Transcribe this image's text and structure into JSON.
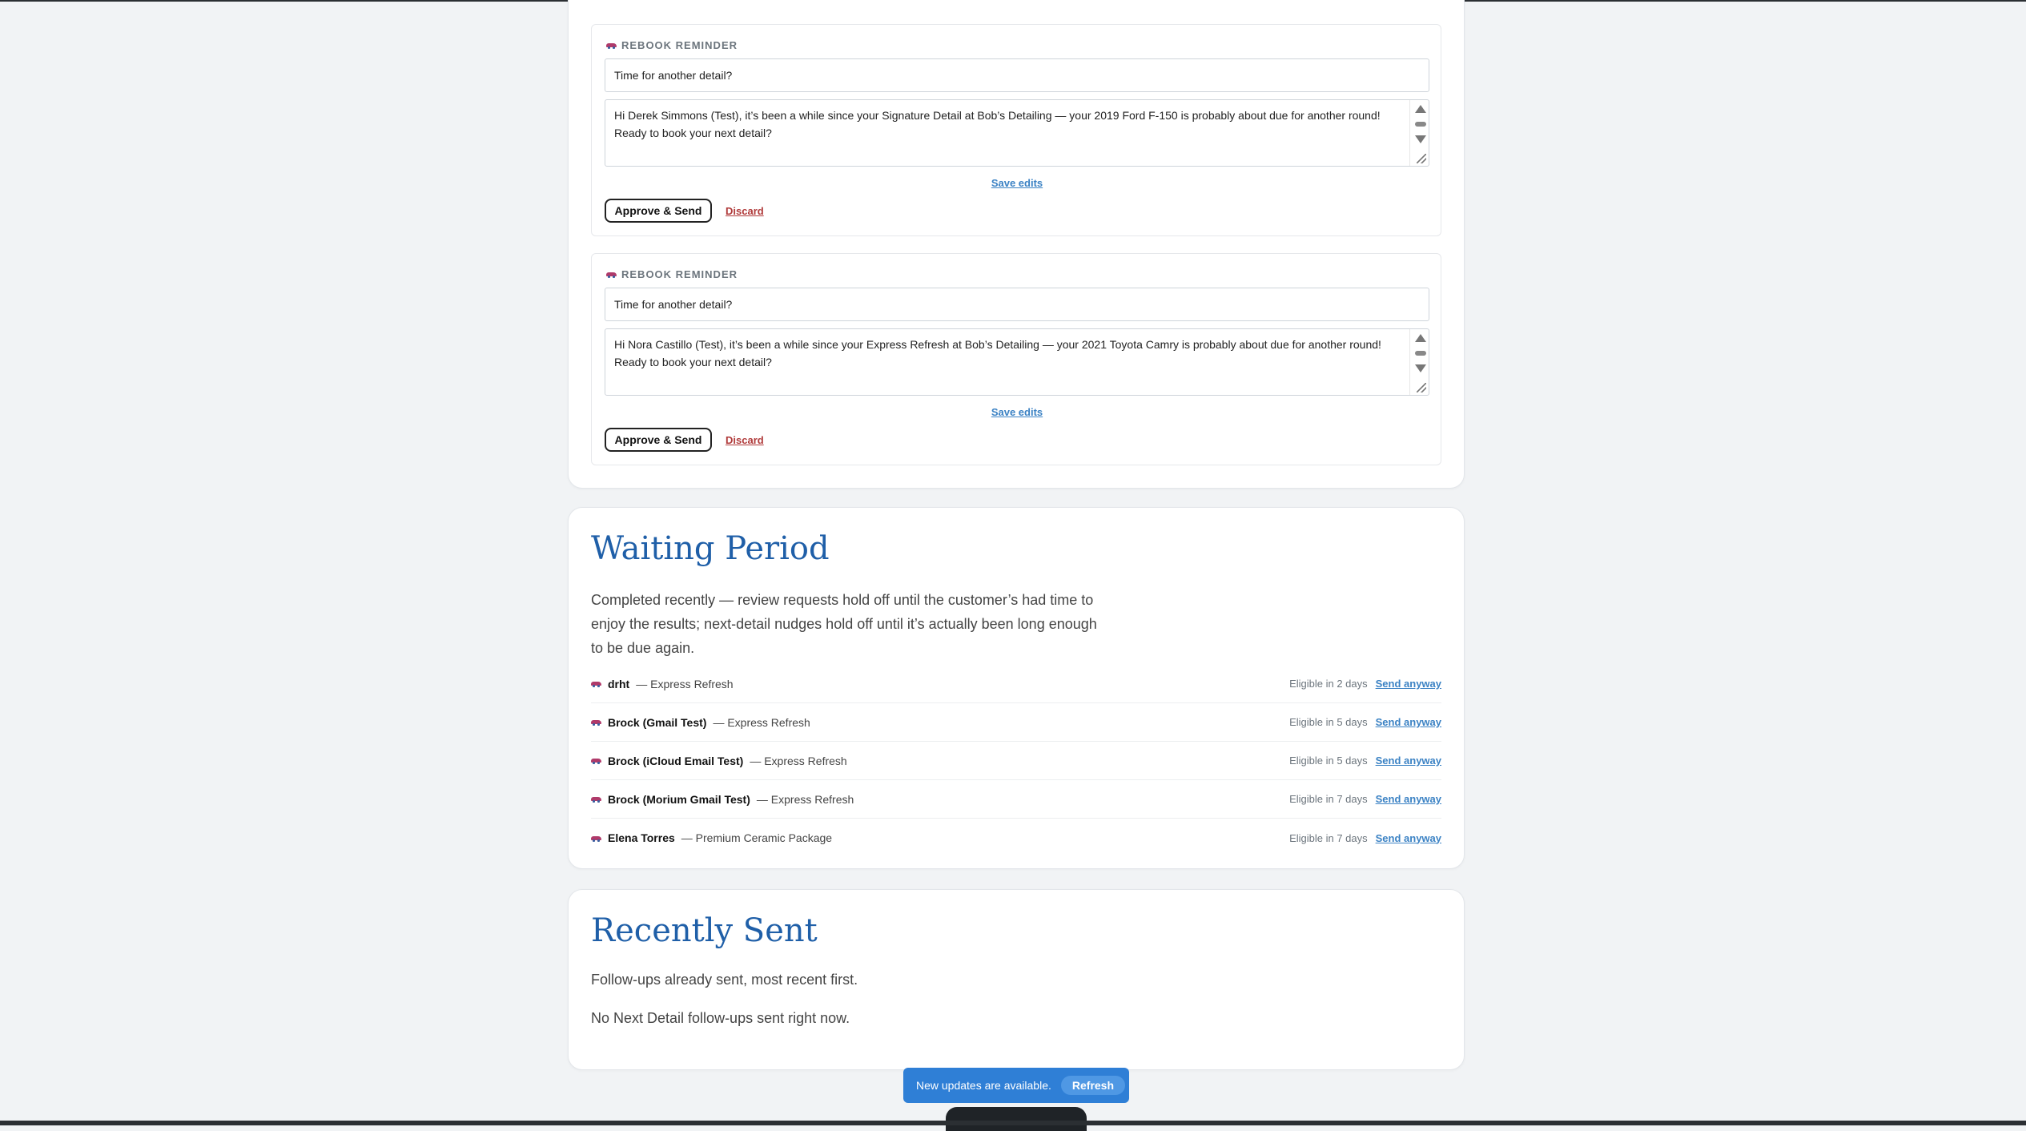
{
  "drafts": [
    {
      "label": "Rebook Reminder",
      "subject": "Time for another detail?",
      "body_line1": "Hi Derek Simmons (Test), it’s been a while since your Signature Detail at Bob’s Detailing — your 2019 Ford F-150 is probably about due for another round!",
      "body_line2": "Ready to book your next detail?",
      "save_label": "Save edits",
      "approve_label": "Approve & Send",
      "discard_label": "Discard"
    },
    {
      "label": "Rebook Reminder",
      "subject": "Time for another detail?",
      "body_line1": "Hi Nora Castillo (Test), it’s been a while since your Express Refresh at Bob’s Detailing — your 2021 Toyota Camry is probably about due for another round!",
      "body_line2": "Ready to book your next detail?",
      "save_label": "Save edits",
      "approve_label": "Approve & Send",
      "discard_label": "Discard"
    }
  ],
  "waiting": {
    "title": "Waiting Period",
    "description": "Completed recently — review requests hold off until the customer’s had time to enjoy the results; next-detail nudges hold off until it’s actually been long enough to be due again.",
    "rows": [
      {
        "name": "drht",
        "service": "— Express Refresh",
        "eligible": "Eligible in 2 days",
        "action": "Send anyway"
      },
      {
        "name": "Brock (Gmail Test)",
        "service": "— Express Refresh",
        "eligible": "Eligible in 5 days",
        "action": "Send anyway"
      },
      {
        "name": "Brock (iCloud Email Test)",
        "service": "— Express Refresh",
        "eligible": "Eligible in 5 days",
        "action": "Send anyway"
      },
      {
        "name": "Brock (Morium Gmail Test)",
        "service": "— Express Refresh",
        "eligible": "Eligible in 7 days",
        "action": "Send anyway"
      },
      {
        "name": "Elena Torres",
        "service": "— Premium Ceramic Package",
        "eligible": "Eligible in 7 days",
        "action": "Send anyway"
      }
    ]
  },
  "recent": {
    "title": "Recently Sent",
    "description": "Follow-ups already sent, most recent first.",
    "empty": "No Next Detail follow-ups sent right now."
  },
  "toast": {
    "message": "New updates are available.",
    "button": "Refresh"
  },
  "colors": {
    "accent": "#2f7fd6",
    "heading": "#1f5fa8",
    "link": "#3b82c4",
    "danger": "#b03a3a"
  }
}
